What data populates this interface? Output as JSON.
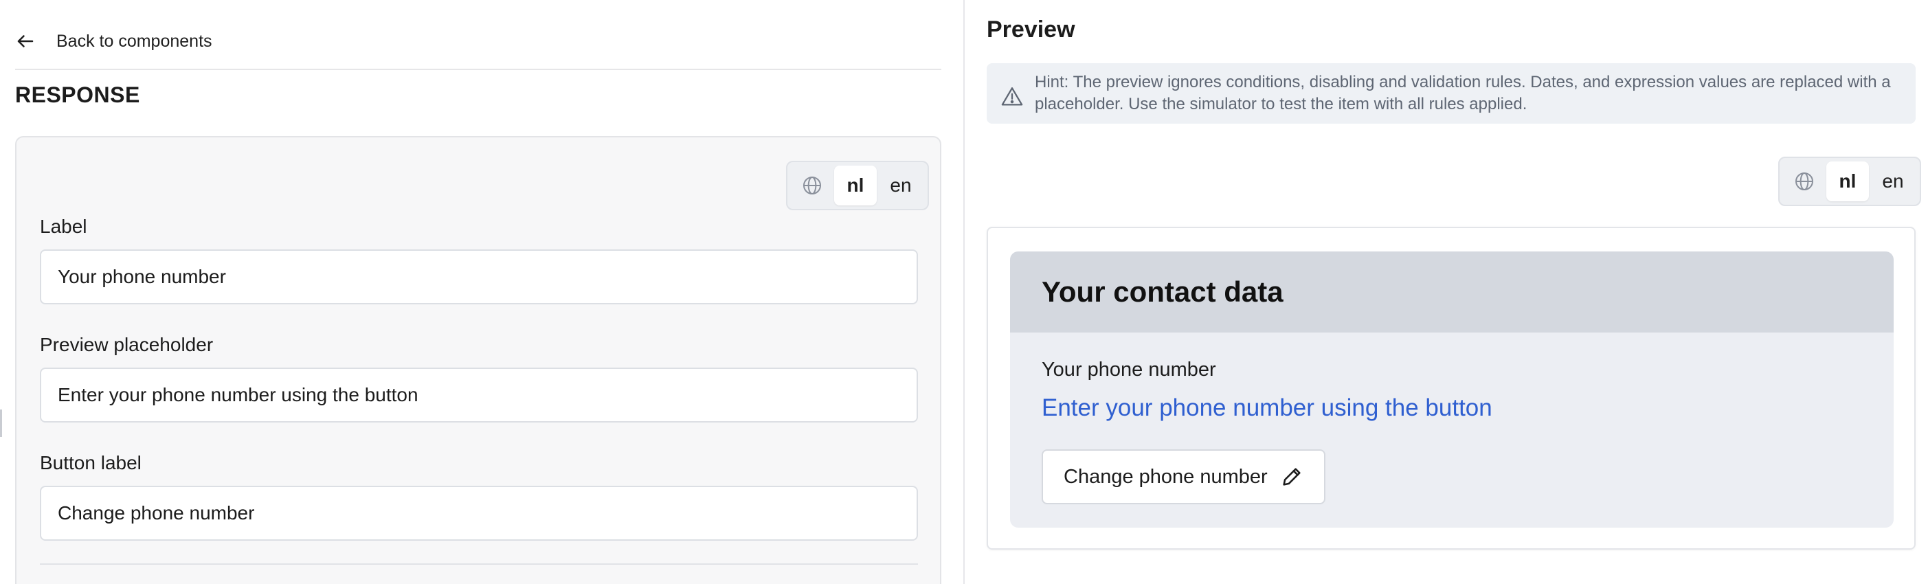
{
  "nav": {
    "back_label": "Back to components"
  },
  "section": {
    "title": "RESPONSE"
  },
  "language_toggle": {
    "icon": "globe-icon",
    "options": [
      "nl",
      "en"
    ],
    "selected": "nl"
  },
  "form": {
    "label_field": {
      "label": "Label",
      "value": "Your phone number"
    },
    "placeholder_field": {
      "label": "Preview placeholder",
      "value": "Enter your phone number using the button"
    },
    "button_field": {
      "label": "Button label",
      "value": "Change phone number"
    }
  },
  "preview": {
    "title": "Preview",
    "hint": "Hint: The preview ignores conditions, disabling and validation rules. Dates, and expression values are replaced with a placeholder. Use the simulator to test the item with all rules applied.",
    "card": {
      "heading": "Your contact data",
      "field_label": "Your phone number",
      "placeholder": "Enter your phone number using the button",
      "button_label": "Change phone number",
      "button_icon": "pencil-icon"
    }
  },
  "colors": {
    "accent_link": "#2f5fd0",
    "card_header": "#d4d8df",
    "card_body": "#eceef3",
    "hint_bg": "#eef1f5"
  }
}
